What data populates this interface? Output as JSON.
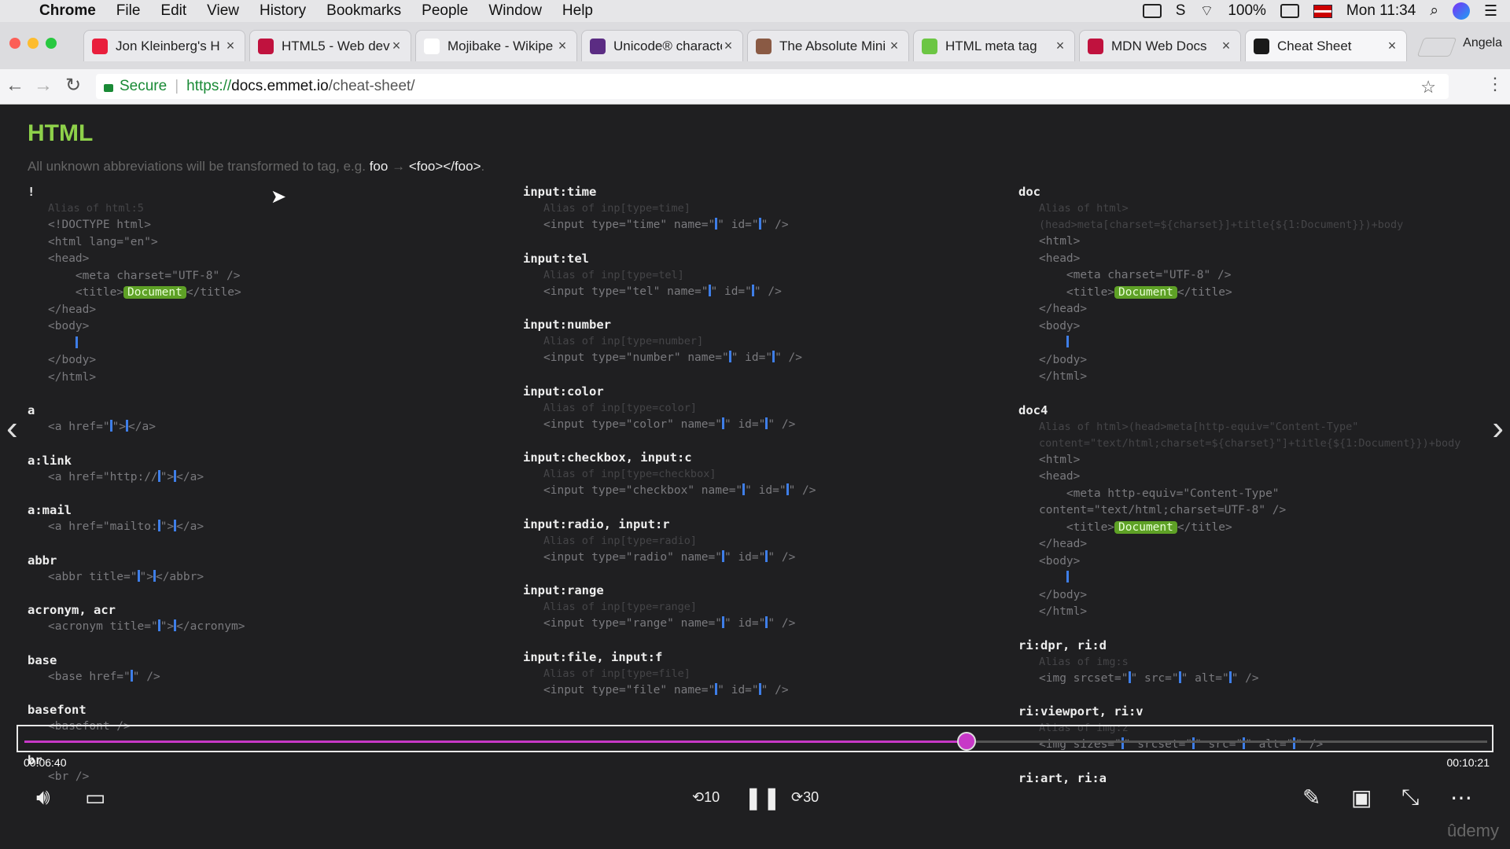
{
  "menubar": {
    "apple_icon": "apple-icon",
    "items": [
      "Chrome",
      "File",
      "Edit",
      "View",
      "History",
      "Bookmarks",
      "People",
      "Window",
      "Help"
    ],
    "battery": "100%",
    "clock": "Mon 11:34",
    "status_icons": [
      "facetime-icon",
      "skype-icon",
      "wifi-icon",
      "battery-icon",
      "flag-icon",
      "search-icon",
      "siri-icon",
      "list-icon"
    ]
  },
  "tabs": [
    {
      "title": "Jon Kleinberg's H",
      "color": "#e91e3c"
    },
    {
      "title": "HTML5 - Web dev",
      "color": "#c0123e"
    },
    {
      "title": "Mojibake - Wikipe",
      "color": "#ffffff"
    },
    {
      "title": "Unicode® characte",
      "color": "#5b2c83"
    },
    {
      "title": "The Absolute Mini",
      "color": "#8a5a44"
    },
    {
      "title": "HTML meta tag",
      "color": "#6cc644"
    },
    {
      "title": "MDN Web Docs",
      "color": "#c0123e"
    },
    {
      "title": "Cheat Sheet",
      "color": "#1a1a1a"
    }
  ],
  "profile": "Angela",
  "address": {
    "secure": "Secure",
    "scheme": "https://",
    "host": "docs.emmet.io",
    "path": "/cheat-sheet/"
  },
  "page": {
    "title": "HTML",
    "intro": "All unknown abbreviations will be transformed to tag, e.g.",
    "intro_kw": "foo",
    "intro_arrow": "→",
    "intro_result": "<foo></foo>",
    "intro_end": "."
  },
  "columns": [
    [
      {
        "name": "!",
        "alias": "Alias of html:5",
        "lines": [
          "<!DOCTYPE html>",
          "<html lang=\"en\">",
          "<head>",
          "    <meta charset=\"UTF-8\" />",
          "    <title>{B:Document}</title>",
          "</head>",
          "<body>",
          "    {C}",
          "</body>",
          "</html>"
        ]
      },
      {
        "name": "a",
        "alias": "",
        "lines": [
          "<a href=\"{C}\">{C}</a>"
        ]
      },
      {
        "name": "a:link",
        "alias": "",
        "lines": [
          "<a href=\"http://{C}\">{C}</a>"
        ]
      },
      {
        "name": "a:mail",
        "alias": "",
        "lines": [
          "<a href=\"mailto:{C}\">{C}</a>"
        ]
      },
      {
        "name": "abbr",
        "alias": "",
        "lines": [
          "<abbr title=\"{C}\">{C}</abbr>"
        ]
      },
      {
        "name": "acronym, acr",
        "alias": "",
        "lines": [
          "<acronym title=\"{C}\">{C}</acronym>"
        ]
      },
      {
        "name": "base",
        "alias": "",
        "lines": [
          "<base href=\"{C}\" />"
        ]
      },
      {
        "name": "basefont",
        "alias": "",
        "lines": [
          "<basefont />"
        ]
      },
      {
        "name": "br",
        "alias": "",
        "lines": [
          "<br />"
        ]
      }
    ],
    [
      {
        "name": "input:time",
        "alias": "Alias of inp[type=time]",
        "lines": [
          "<input type=\"time\" name=\"{C}\" id=\"{C}\" />"
        ]
      },
      {
        "name": "input:tel",
        "alias": "Alias of inp[type=tel]",
        "lines": [
          "<input type=\"tel\" name=\"{C}\" id=\"{C}\" />"
        ]
      },
      {
        "name": "input:number",
        "alias": "Alias of inp[type=number]",
        "lines": [
          "<input type=\"number\" name=\"{C}\" id=\"{C}\" />"
        ]
      },
      {
        "name": "input:color",
        "alias": "Alias of inp[type=color]",
        "lines": [
          "<input type=\"color\" name=\"{C}\" id=\"{C}\" />"
        ]
      },
      {
        "name": "input:checkbox, input:c",
        "alias": "Alias of inp[type=checkbox]",
        "lines": [
          "<input type=\"checkbox\" name=\"{C}\" id=\"{C}\" />"
        ]
      },
      {
        "name": "input:radio, input:r",
        "alias": "Alias of inp[type=radio]",
        "lines": [
          "<input type=\"radio\" name=\"{C}\" id=\"{C}\" />"
        ]
      },
      {
        "name": "input:range",
        "alias": "Alias of inp[type=range]",
        "lines": [
          "<input type=\"range\" name=\"{C}\" id=\"{C}\" />"
        ]
      },
      {
        "name": "input:file, input:f",
        "alias": "Alias of inp[type=file]",
        "lines": [
          "<input type=\"file\" name=\"{C}\" id=\"{C}\" />"
        ]
      }
    ],
    [
      {
        "name": "doc",
        "alias": "Alias of html>\n(head>meta[charset=${charset}]+title{${1:Document}})+body",
        "lines": [
          "<html>",
          "<head>",
          "    <meta charset=\"UTF-8\" />",
          "    <title>{B:Document}</title>",
          "</head>",
          "<body>",
          "    {C}",
          "</body>",
          "</html>"
        ]
      },
      {
        "name": "doc4",
        "alias": "Alias of html>(head>meta[http-equiv=\"Content-Type\"\ncontent=\"text/html;charset=${charset}\"]+title{${1:Document}})+body",
        "lines": [
          "<html>",
          "<head>",
          "    <meta http-equiv=\"Content-Type\"",
          "content=\"text/html;charset=UTF-8\" />",
          "    <title>{B:Document}</title>",
          "</head>",
          "<body>",
          "    {C}",
          "</body>",
          "</html>"
        ]
      },
      {
        "name": "ri:dpr, ri:d",
        "alias": "Alias of img:s",
        "lines": [
          "<img srcset=\"{C}\" src=\"{C}\" alt=\"{C}\" />"
        ]
      },
      {
        "name": "ri:viewport, ri:v",
        "alias": "Alias of img:z",
        "lines": [
          "<img sizes=\"{C}\" srcset=\"{C}\" src=\"{C}\" alt=\"{C}\" />"
        ]
      },
      {
        "name": "ri:art, ri:a",
        "alias": "",
        "lines": []
      }
    ]
  ],
  "player": {
    "elapsed": "00:06:40",
    "duration": "00:10:21",
    "progress": 0.644,
    "rewind_label": "10",
    "forward_label": "30",
    "brand": "ûdemy",
    "accent": "#c738c7"
  }
}
